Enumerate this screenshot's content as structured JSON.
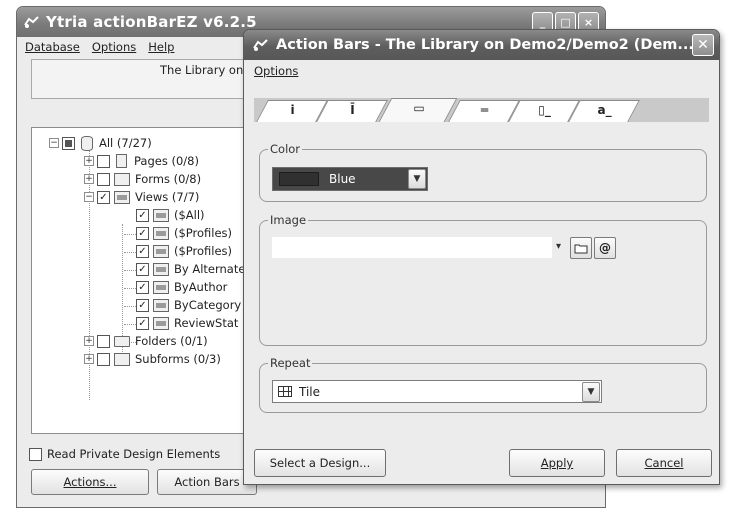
{
  "main_window": {
    "title": "Ytria actionBarEZ v6.2.5",
    "menu": [
      "Database",
      "Options",
      "Help"
    ],
    "library_text": "The Library on D",
    "tree": {
      "root": "All (7/27)",
      "pages": "Pages (0/8)",
      "forms": "Forms (0/8)",
      "views": "Views (7/7)",
      "view_items": [
        "($All)",
        "($Profiles)",
        "($Profiles)",
        "By Alternate",
        "ByAuthor",
        "ByCategory",
        "ReviewStat"
      ],
      "folders": "Folders (0/1)",
      "subforms": "Subforms (0/3)"
    },
    "read_private_label": "Read Private Design Elements",
    "actions_button": "Actions...",
    "action_bars_button": "Action Bars"
  },
  "dialog": {
    "title": "Action Bars - The Library on Demo2/Demo2 (Dem...",
    "menu": "Options",
    "tabs": [
      "i",
      "Ī",
      "▭",
      "═",
      "▯_",
      "a_"
    ],
    "color_label": "Color",
    "color_value": "Blue",
    "color_swatch": "#303030",
    "image_label": "Image",
    "image_value": "",
    "image_dropdown": "▾",
    "folder_button": "folder-icon",
    "formula_button": "@",
    "repeat_label": "Repeat",
    "repeat_value": "Tile",
    "select_design_button": "Select a Design...",
    "apply_button": "Apply",
    "cancel_button": "Cancel"
  }
}
